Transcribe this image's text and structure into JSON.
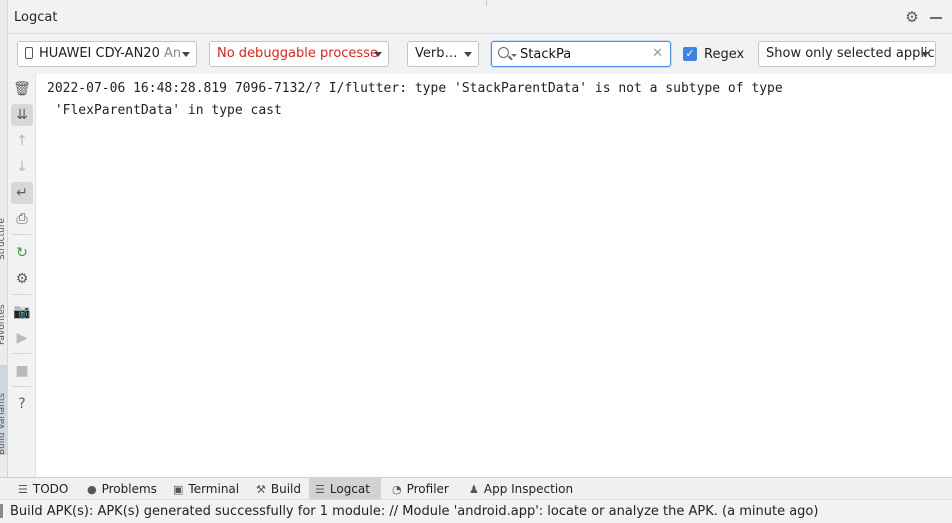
{
  "side_tabs": [
    "Structure",
    "Favorites",
    "Build Variants"
  ],
  "header": {
    "title": "Logcat",
    "settings_icon": "gear-icon",
    "hide_icon": "minimize-icon"
  },
  "toolbar": {
    "device": {
      "name": "HUAWEI CDY-AN20",
      "suffix": "An"
    },
    "process": "No debuggable processe",
    "log_level": "Verb…",
    "search": {
      "value": "StackPa",
      "clear_icon": "✕"
    },
    "regex": {
      "label": "Regex",
      "checked": true
    },
    "filter": "Show only selected applic"
  },
  "side_buttons": [
    {
      "name": "clear-logcat-icon",
      "glyph": "🗑"
    },
    {
      "name": "scroll-to-end-icon",
      "glyph": "⇊"
    },
    {
      "name": "up-arrow-icon",
      "glyph": "↑"
    },
    {
      "name": "down-arrow-icon",
      "glyph": "↓"
    },
    {
      "name": "soft-wrap-icon",
      "glyph": "↵"
    },
    {
      "name": "print-icon",
      "glyph": "⎙"
    },
    {
      "name": "restart-icon",
      "glyph": "↻"
    },
    {
      "name": "settings-icon",
      "glyph": "⚙"
    },
    {
      "name": "screen-capture-icon",
      "glyph": "📷"
    },
    {
      "name": "screen-record-icon",
      "glyph": "▶"
    },
    {
      "name": "terminate-icon",
      "glyph": "■"
    },
    {
      "name": "help-icon",
      "glyph": "?"
    }
  ],
  "log_lines": [
    "2022-07-06 16:48:28.819 7096-7132/? I/flutter: type 'StackParentData' is not a subtype of type",
    " 'FlexParentData' in type cast"
  ],
  "bottom_tabs": [
    {
      "label": "TODO",
      "icon": "list-icon",
      "glyph": "☰"
    },
    {
      "label": "Problems",
      "icon": "problems-icon",
      "glyph": "●"
    },
    {
      "label": "Terminal",
      "icon": "terminal-icon",
      "glyph": "▣"
    },
    {
      "label": "Build",
      "icon": "hammer-icon",
      "glyph": "⚒"
    },
    {
      "label": "Logcat",
      "icon": "logcat-icon",
      "glyph": "☰",
      "active": true
    },
    {
      "label": "Profiler",
      "icon": "profiler-icon",
      "glyph": "◔"
    },
    {
      "label": "App Inspection",
      "icon": "app-inspection-icon",
      "glyph": "♟"
    }
  ],
  "status": {
    "message": "Build APK(s): APK(s) generated successfully for 1 module: // Module 'android.app': locate or analyze the APK. (a minute ago)"
  },
  "colors": {
    "process_error": "#d0271d",
    "accent": "#3d85dc",
    "restart_green": "#3a9a3a"
  }
}
